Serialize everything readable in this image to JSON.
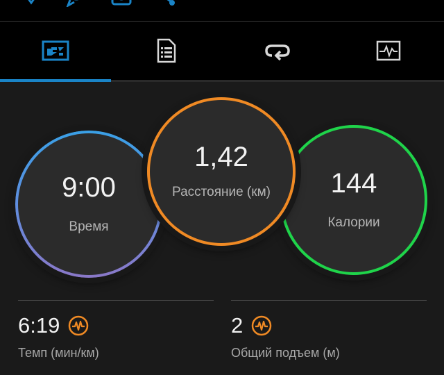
{
  "tabs": [
    {
      "icon": "summary-chart-icon",
      "active": true
    },
    {
      "icon": "document-list-icon",
      "active": false
    },
    {
      "icon": "repeat-laps-icon",
      "active": false
    },
    {
      "icon": "activity-graph-icon",
      "active": false
    }
  ],
  "top_actions": [
    {
      "icon": "heart-icon"
    },
    {
      "icon": "comment-icon"
    },
    {
      "icon": "camera-icon"
    },
    {
      "icon": "share-icon"
    }
  ],
  "circles": {
    "time": {
      "value": "9:00",
      "label": "Время",
      "color": "#3aa0e6"
    },
    "distance": {
      "value": "1,42",
      "label": "Расстояние (км)",
      "color": "#f08a24"
    },
    "calories": {
      "value": "144",
      "label": "Калории",
      "color": "#1fd44a"
    }
  },
  "stats": {
    "pace": {
      "value": "6:19",
      "label": "Темп (мин/км)",
      "icon": "pulse-icon"
    },
    "ascent": {
      "value": "2",
      "label": "Общий подъем (м)",
      "icon": "pulse-icon"
    }
  },
  "colors": {
    "accent": "#1a84c7",
    "stat_icon": "#f08a24"
  }
}
